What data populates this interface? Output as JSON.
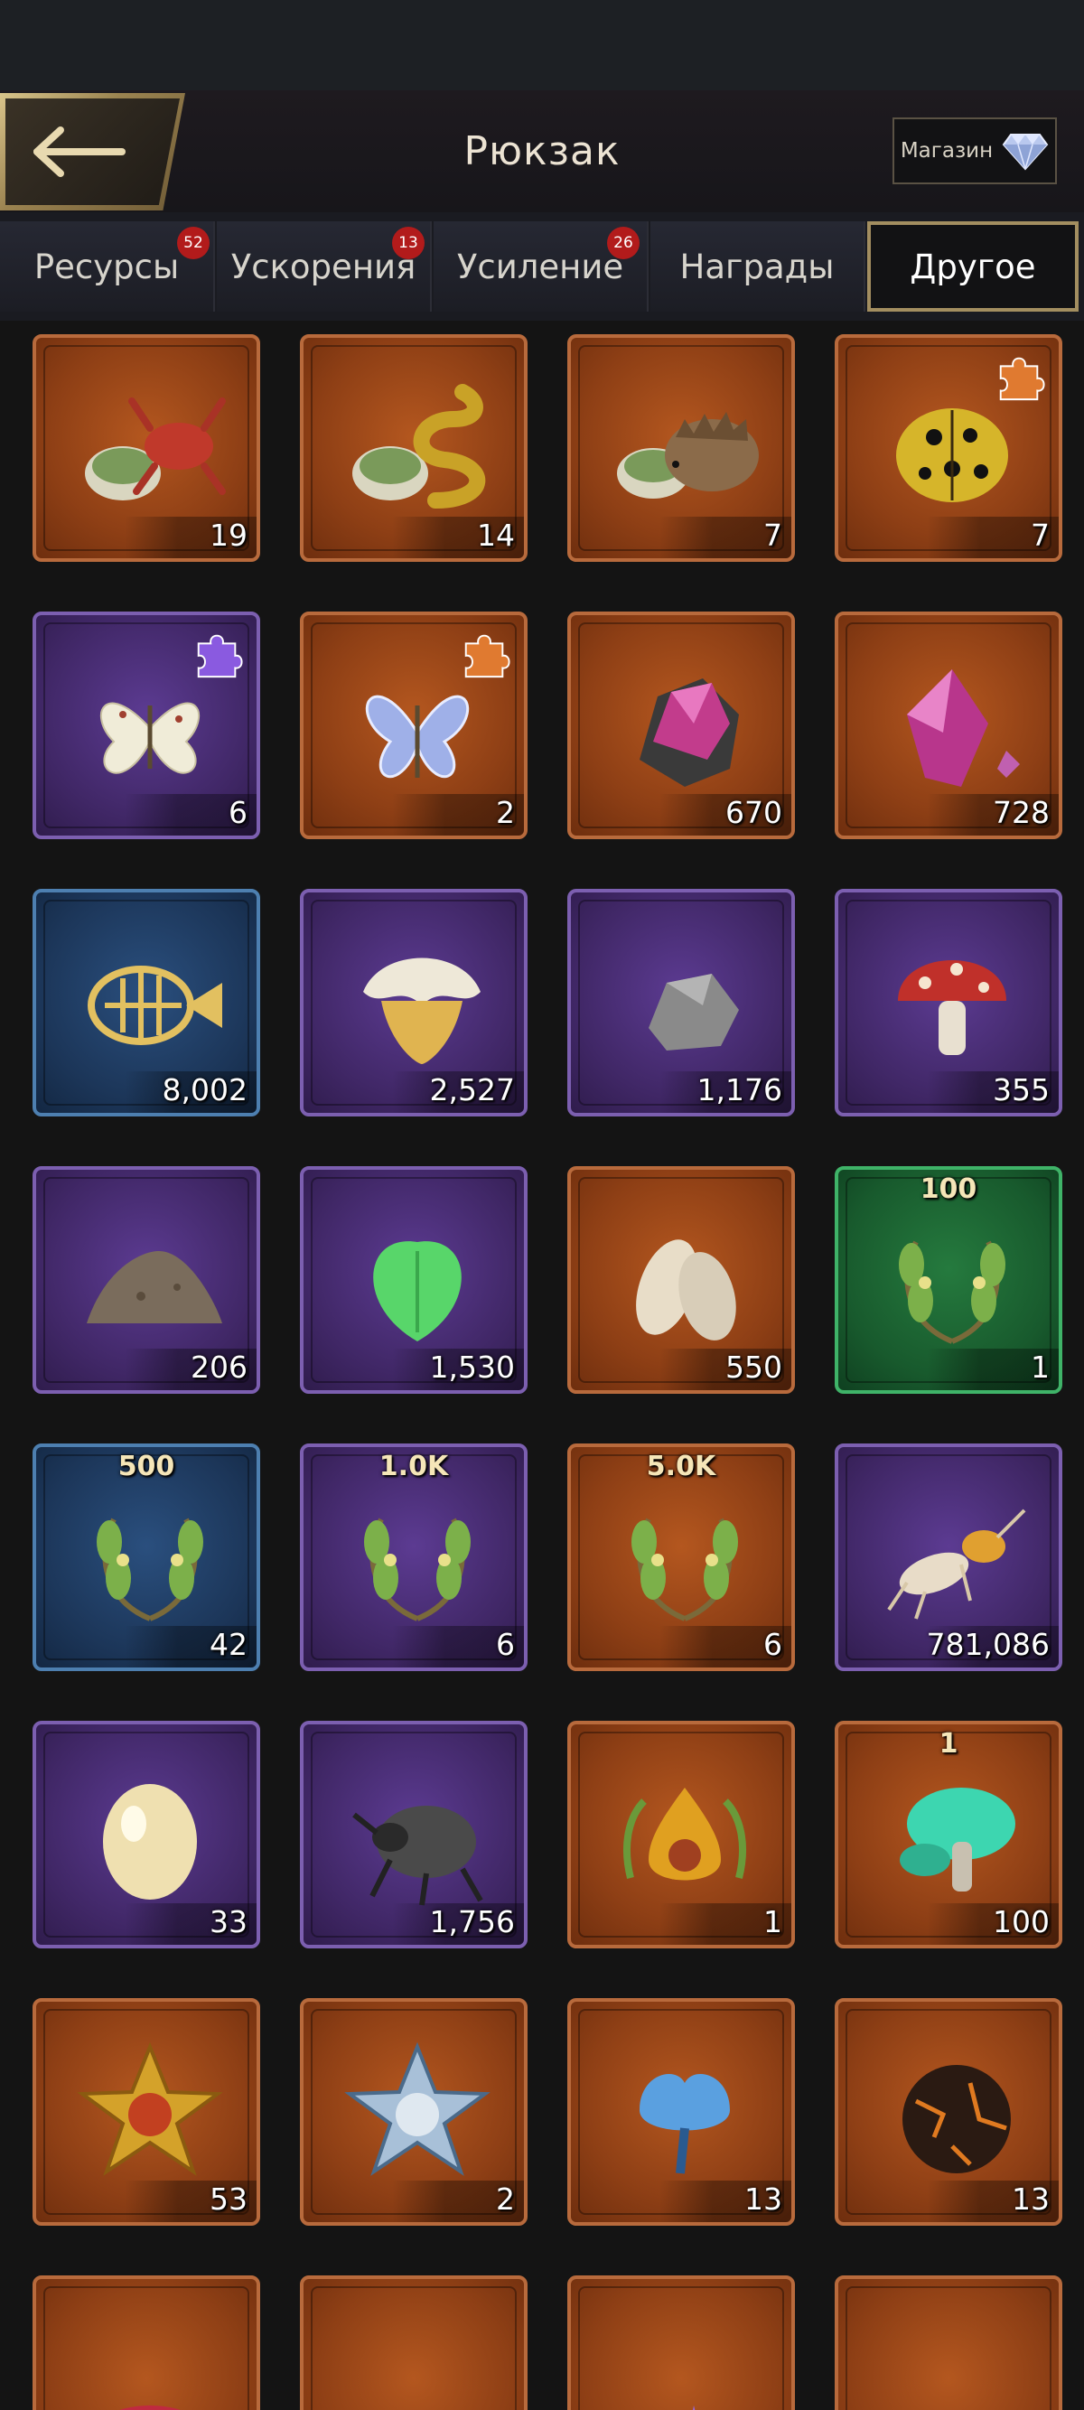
{
  "header": {
    "title": "Рюкзак",
    "shop_label": "Магазин"
  },
  "tabs": [
    {
      "label": "Ресурсы",
      "badge": "52"
    },
    {
      "label": "Ускорения",
      "badge": "13"
    },
    {
      "label": "Усиление",
      "badge": "26"
    },
    {
      "label": "Награды",
      "badge": ""
    },
    {
      "label": "Другое",
      "badge": "",
      "active": true
    }
  ],
  "colors": {
    "orange": "#8e3f15",
    "purple": "#402766",
    "blue": "#1c3659",
    "green": "#185a2d",
    "badge": "#b21b1b",
    "active_tab_border": "#a38e60"
  },
  "items": [
    {
      "name": "crab-clam-bait",
      "icon": "crab-icon",
      "rarity": "orange",
      "count": "19"
    },
    {
      "name": "snake-clam-bait",
      "icon": "snake-icon",
      "rarity": "orange",
      "count": "14"
    },
    {
      "name": "hedgehog-clam-bait",
      "icon": "hedgehog-icon",
      "rarity": "orange",
      "count": "7"
    },
    {
      "name": "ladybug-fragment",
      "icon": "ladybug-icon",
      "rarity": "orange",
      "count": "7",
      "puzzle": true
    },
    {
      "name": "white-butterfly-fragment",
      "icon": "white-butterfly-icon",
      "rarity": "purple",
      "count": "6",
      "puzzle": true
    },
    {
      "name": "blue-butterfly-fragment",
      "icon": "blue-butterfly-icon",
      "rarity": "orange",
      "count": "2",
      "puzzle": true
    },
    {
      "name": "crystal-ore",
      "icon": "crystal-ore-icon",
      "rarity": "orange",
      "count": "670"
    },
    {
      "name": "crystal-shards",
      "icon": "crystal-shard-icon",
      "rarity": "orange",
      "count": "728"
    },
    {
      "name": "fish-skeleton",
      "icon": "fish-skeleton-icon",
      "rarity": "blue",
      "count": "8,002"
    },
    {
      "name": "oyster-mushroom",
      "icon": "oyster-mushroom-icon",
      "rarity": "purple",
      "count": "2,527"
    },
    {
      "name": "stone",
      "icon": "stone-icon",
      "rarity": "purple",
      "count": "1,176"
    },
    {
      "name": "red-mushroom",
      "icon": "red-mushroom-icon",
      "rarity": "purple",
      "count": "355"
    },
    {
      "name": "soil-pile",
      "icon": "soil-icon",
      "rarity": "purple",
      "count": "206"
    },
    {
      "name": "green-leaf",
      "icon": "leaf-icon",
      "rarity": "purple",
      "count": "1,530"
    },
    {
      "name": "seeds",
      "icon": "seeds-icon",
      "rarity": "orange",
      "count": "550"
    },
    {
      "name": "laurel-100",
      "icon": "laurel-icon",
      "rarity": "green",
      "label": "100",
      "count": "1"
    },
    {
      "name": "laurel-500",
      "icon": "laurel-icon",
      "rarity": "blue",
      "label": "500",
      "count": "42"
    },
    {
      "name": "laurel-1k",
      "icon": "laurel-icon",
      "rarity": "purple",
      "label": "1.0K",
      "count": "6"
    },
    {
      "name": "laurel-5k",
      "icon": "laurel-icon",
      "rarity": "orange",
      "label": "5.0K",
      "count": "6"
    },
    {
      "name": "termite",
      "icon": "termite-icon",
      "rarity": "purple",
      "count": "781,086"
    },
    {
      "name": "egg",
      "icon": "egg-icon",
      "rarity": "purple",
      "count": "33"
    },
    {
      "name": "rhino-beetle",
      "icon": "beetle-icon",
      "rarity": "purple",
      "count": "1,756"
    },
    {
      "name": "amber-emblem",
      "icon": "amber-emblem-icon",
      "rarity": "orange",
      "count": "1"
    },
    {
      "name": "teal-mushroom",
      "icon": "teal-mushroom-icon",
      "rarity": "orange",
      "label": "1",
      "count": "100"
    },
    {
      "name": "gold-star-badge",
      "icon": "gold-star-badge-icon",
      "rarity": "orange",
      "count": "53"
    },
    {
      "name": "silver-star-badge",
      "icon": "silver-star-badge-icon",
      "rarity": "orange",
      "count": "2"
    },
    {
      "name": "blue-flower",
      "icon": "blue-flower-icon",
      "rarity": "orange",
      "count": "13"
    },
    {
      "name": "lava-orb",
      "icon": "lava-orb-icon",
      "rarity": "orange",
      "count": "13"
    },
    {
      "name": "red-flower",
      "icon": "red-flower-icon",
      "rarity": "orange",
      "count": ""
    },
    {
      "name": "green-leaves",
      "icon": "green-leaves-icon",
      "rarity": "orange",
      "count": ""
    },
    {
      "name": "purple-crystals",
      "icon": "purple-crystals-icon",
      "rarity": "orange",
      "count": ""
    },
    {
      "name": "blue-crystals",
      "icon": "blue-crystals-icon",
      "rarity": "orange",
      "count": ""
    }
  ]
}
